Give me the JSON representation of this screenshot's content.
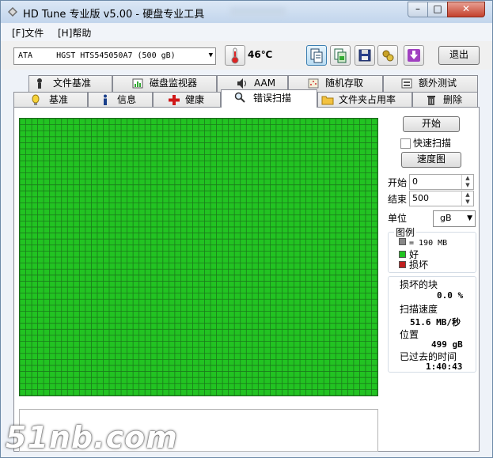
{
  "window": {
    "title": "HD Tune 专业版 v5.00 - 硬盘专业工具",
    "minimize": "–",
    "maximize": "□",
    "close": "✕"
  },
  "menu": [
    {
      "label": "[F]文件"
    },
    {
      "label": "[H]帮助"
    }
  ],
  "toolbar": {
    "drive": "ATA     HGST HTS545050A7 (500 gB)",
    "temperature": "46℃",
    "exit_label": "退出",
    "icons": [
      "copy-text-icon",
      "copy-screenshot-icon",
      "save-icon",
      "options-icon",
      "download-icon"
    ]
  },
  "tabs": {
    "row1": [
      {
        "label": "文件基准",
        "icon": "file-benchmark-icon"
      },
      {
        "label": "磁盘监视器",
        "icon": "disk-monitor-icon"
      },
      {
        "label": "AAM",
        "icon": "speaker-icon"
      },
      {
        "label": "随机存取",
        "icon": "random-access-icon"
      },
      {
        "label": "额外测试",
        "icon": "extra-tests-icon"
      }
    ],
    "row2": [
      {
        "label": "基准",
        "icon": "benchmark-icon"
      },
      {
        "label": "信息",
        "icon": "info-icon"
      },
      {
        "label": "健康",
        "icon": "health-cross-icon"
      },
      {
        "label": "错误扫描",
        "icon": "magnifier-icon",
        "selected": true
      },
      {
        "label": "文件夹占用率",
        "icon": "folder-icon"
      },
      {
        "label": "删除",
        "icon": "trash-icon"
      }
    ]
  },
  "scan": {
    "start_button": "开始",
    "quick_scan_label": "快速扫描",
    "quick_scan_checked": false,
    "speed_map_button": "速度图",
    "start_label": "开始",
    "start_value": "0",
    "end_label": "结束",
    "end_value": "500",
    "unit_label": "单位",
    "unit_value": "gB",
    "legend": {
      "title": "图例",
      "block_size": "= 190 MB",
      "good": "好",
      "bad": "损坏"
    },
    "stats": {
      "damaged_blocks_label": "损坏的块",
      "damaged_blocks_value": "0.0 %",
      "scan_speed_label": "扫描速度",
      "scan_speed_value": "51.6 MB/秒",
      "position_label": "位置",
      "position_value": "499 gB",
      "elapsed_label": "已过去的时间",
      "elapsed_value": "1:40:43"
    }
  },
  "colors": {
    "good": "#22c322",
    "bad": "#c02020",
    "grid_line": "#1b7a1b"
  },
  "watermark": "51nb.com"
}
